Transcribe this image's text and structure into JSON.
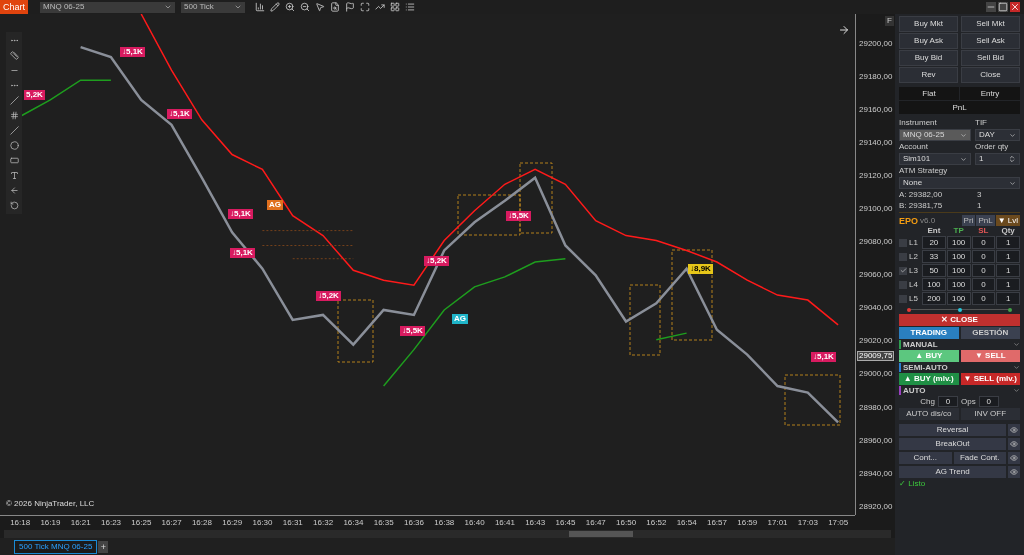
{
  "toolbar": {
    "app_button": "Chart",
    "instrument": "MNQ 06-25",
    "interval": "500 Tick"
  },
  "chart": {
    "panel_button": "F",
    "badges": [
      {
        "text": "5,2K",
        "color": "#d81b60"
      },
      {
        "text": "↓5,1K",
        "color": "#d81b60"
      },
      {
        "text": "↓5,1K",
        "color": "#d81b60"
      },
      {
        "text": "↓5,1K",
        "color": "#d81b60"
      },
      {
        "text": "AG",
        "color": "#e0701e"
      },
      {
        "text": "↓5,1K",
        "color": "#d81b60"
      },
      {
        "text": "↓5,2K",
        "color": "#d81b60"
      },
      {
        "text": "↓5,5K",
        "color": "#d81b60"
      },
      {
        "text": "↓5,2K",
        "color": "#d81b60"
      },
      {
        "text": "AG",
        "color": "#1fb5c9"
      },
      {
        "text": "↓5,5K",
        "color": "#d81b60"
      },
      {
        "text": "↓8,9K",
        "color": "#e6c619"
      },
      {
        "text": "↓5,1K",
        "color": "#d81b60"
      }
    ],
    "copyright": "© 2026 NinjaTrader, LLC",
    "last_price": "29009,75",
    "chart_data": {
      "type": "line",
      "categories": [
        "16:18",
        "16:19",
        "16:21",
        "16:23",
        "16:25",
        "16:27",
        "16:28",
        "16:29",
        "16:30",
        "16:31",
        "16:32",
        "16:34",
        "16:35",
        "16:36",
        "16:38",
        "16:40",
        "16:41",
        "16:43",
        "16:45",
        "16:47",
        "16:50",
        "16:52",
        "16:54",
        "16:57",
        "16:59",
        "17:01",
        "17:03",
        "17:05"
      ],
      "series": [
        {
          "color": "#8a8f99",
          "values": [
            null,
            null,
            29198,
            29192,
            29166,
            29151,
            29119,
            29086,
            29064,
            29033,
            29036,
            29018,
            29039,
            29036,
            29075,
            29092,
            29105,
            29119,
            29078,
            29060,
            29032,
            29043,
            29064,
            29027,
            29012,
            28993,
            28989,
            28971
          ]
        },
        {
          "color": "#ff1a1a",
          "values": [
            null,
            null,
            null,
            null,
            29218,
            29184,
            29154,
            29133,
            29124,
            29096,
            29084,
            29063,
            29057,
            29054,
            29081,
            29099,
            29115,
            29124,
            29115,
            29093,
            29084,
            29081,
            29075,
            29068,
            29057,
            29048,
            29045,
            29030
          ]
        },
        {
          "color": "#1e9e1e",
          "values": [
            29156,
            29166,
            29178,
            29178,
            null,
            null,
            null,
            null,
            null,
            null,
            null,
            null,
            28993,
            29015,
            29039,
            29053,
            29059,
            29068,
            29070,
            null,
            null,
            29021,
            29025,
            null,
            null,
            null,
            null,
            null
          ]
        },
        {
          "color": "#8a4a1a",
          "line_style": "dashed",
          "values": [
            null,
            null,
            null,
            null,
            null,
            null,
            null,
            null,
            29087,
            29087,
            29087,
            29087,
            null,
            null,
            null,
            null,
            null,
            null,
            null,
            null,
            null,
            null,
            null,
            null,
            null,
            null,
            null,
            null
          ]
        },
        {
          "color": "#8a4a1a",
          "line_style": "dashed",
          "values": [
            null,
            null,
            null,
            null,
            null,
            null,
            null,
            null,
            29078,
            29078,
            29078,
            29078,
            null,
            null,
            null,
            null,
            null,
            null,
            null,
            null,
            null,
            null,
            null,
            null,
            null,
            null,
            null,
            null
          ]
        },
        {
          "color": "#8a4a1a",
          "line_style": "dashed",
          "values": [
            null,
            null,
            null,
            null,
            null,
            null,
            null,
            null,
            null,
            29070,
            29070,
            29070,
            null,
            null,
            null,
            null,
            null,
            null,
            null,
            null,
            null,
            null,
            null,
            null,
            null,
            null,
            null,
            null
          ]
        }
      ],
      "ylim": [
        28915,
        29218
      ],
      "yticks": [
        {
          "value": 29200,
          "label": "29200,00"
        },
        {
          "value": 29180,
          "label": "29180,00"
        },
        {
          "value": 29160,
          "label": "29160,00"
        },
        {
          "value": 29140,
          "label": "29140,00"
        },
        {
          "value": 29120,
          "label": "29120,00"
        },
        {
          "value": 29100,
          "label": "29100,00"
        },
        {
          "value": 29080,
          "label": "29080,00"
        },
        {
          "value": 29060,
          "label": "29060,00"
        },
        {
          "value": 29040,
          "label": "29040,00"
        },
        {
          "value": 29020,
          "label": "29020,00"
        },
        {
          "value": 29000,
          "label": "29000,00"
        },
        {
          "value": 28980,
          "label": "28980,00"
        },
        {
          "value": 28960,
          "label": "28960,00"
        },
        {
          "value": 28940,
          "label": "28940,00"
        },
        {
          "value": 28920,
          "label": "28920,00"
        }
      ]
    }
  },
  "tabs": [
    {
      "label": "500 Tick MNQ 06-25",
      "selected": true
    }
  ],
  "add_tab": "+",
  "order_panel": {
    "order_buttons": [
      "Buy Mkt",
      "Sell Mkt",
      "Buy Ask",
      "Sell Ask",
      "Buy Bid",
      "Sell Bid",
      "Rev",
      "Close"
    ],
    "position_fields": [
      "Flat",
      "Entry",
      "PnL"
    ],
    "instrument": {
      "label": "Instrument",
      "value": "MNQ 06-25",
      "disabled": true
    },
    "tif": {
      "label": "TIF",
      "value": "DAY"
    },
    "account": {
      "label": "Account",
      "value": "Sim101"
    },
    "order_qty": {
      "label": "Order qty",
      "value": "1"
    },
    "atm_strategy": {
      "label": "ATM Strategy",
      "value": "None"
    },
    "quotes": [
      {
        "label": "A:",
        "price": "29382,00",
        "size": "3"
      },
      {
        "label": "B:",
        "price": "29381,75",
        "size": "1"
      }
    ]
  },
  "epo": {
    "title": "EPO",
    "version": "v6.0",
    "view_buttons": [
      {
        "label": "Pri",
        "selected": false
      },
      {
        "label": "PnL",
        "selected": false
      },
      {
        "label": "▼ Lvl",
        "selected": true
      }
    ],
    "columns": [
      {
        "label": "Ent",
        "color": "#c8c8c8"
      },
      {
        "label": "TP",
        "color": "#4caf50"
      },
      {
        "label": "SL",
        "color": "#e05555"
      },
      {
        "label": "Qty",
        "color": "#c8c8c8"
      }
    ],
    "levels": [
      {
        "label": "L1",
        "checked": false,
        "ent": "20",
        "tp": "100",
        "sl": "0",
        "qty": "1"
      },
      {
        "label": "L2",
        "checked": false,
        "ent": "33",
        "tp": "100",
        "sl": "0",
        "qty": "1"
      },
      {
        "label": "L3",
        "checked": true,
        "ent": "50",
        "tp": "100",
        "sl": "0",
        "qty": "1"
      },
      {
        "label": "L4",
        "checked": false,
        "ent": "100",
        "tp": "100",
        "sl": "0",
        "qty": "1"
      },
      {
        "label": "L5",
        "checked": false,
        "ent": "200",
        "tp": "100",
        "sl": "0",
        "qty": "1"
      }
    ],
    "markers": [
      {
        "color": "#e53935"
      },
      {
        "color": "#26c6da"
      },
      {
        "color": "#43a047"
      }
    ],
    "close_button": "✕ CLOSE",
    "modes": [
      {
        "label": "TRADING",
        "selected": true
      },
      {
        "label": "GESTIÓN",
        "selected": false
      }
    ],
    "sections": [
      {
        "kind": "buttons",
        "title": "MANUAL",
        "color": "#2e9e4f",
        "buttons": [
          {
            "label": "▲ BUY",
            "color": "#5cc77f"
          },
          {
            "label": "▼ SELL",
            "color": "#e06a6a"
          }
        ]
      },
      {
        "kind": "buttons",
        "title": "SEMI-AUTO",
        "color": "#2a7fd0",
        "buttons": [
          {
            "label": "▲ BUY (mlv.)",
            "color": "#1f8f45"
          },
          {
            "label": "▼ SELL (mlv.)",
            "color": "#c62828"
          }
        ]
      },
      {
        "kind": "auto",
        "title": "AUTO",
        "color": "#9b3fc0",
        "fields": [
          {
            "label": "Chg",
            "value": "0"
          },
          {
            "label": "Ops",
            "value": "0"
          }
        ],
        "buttons": [
          "AUTO dis/co",
          "INV OFF"
        ]
      }
    ],
    "strategies": [
      {
        "buttons": [
          "Reversal"
        ]
      },
      {
        "buttons": [
          "BreakOut"
        ]
      },
      {
        "buttons": [
          "Cont...",
          "Fade Cont."
        ]
      },
      {
        "buttons": [
          "AG Trend"
        ]
      }
    ],
    "status": "✓ Listo"
  }
}
